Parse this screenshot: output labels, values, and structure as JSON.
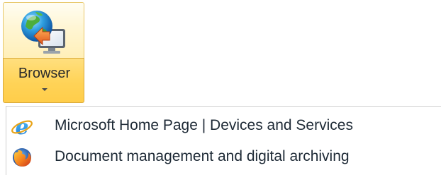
{
  "ribbon": {
    "button_label": "Browser",
    "icon": "globe-monitor-icon",
    "state": "hover-open"
  },
  "menu": {
    "items": [
      {
        "label": "Microsoft Home Page | Devices and Services",
        "icon": "internet-explorer-icon"
      },
      {
        "label": "Document management and digital archiving",
        "icon": "firefox-icon"
      }
    ]
  },
  "colors": {
    "ribbon_highlight": "#ffd357",
    "ribbon_border": "#d9a93a",
    "menu_text": "#1e2a36"
  }
}
